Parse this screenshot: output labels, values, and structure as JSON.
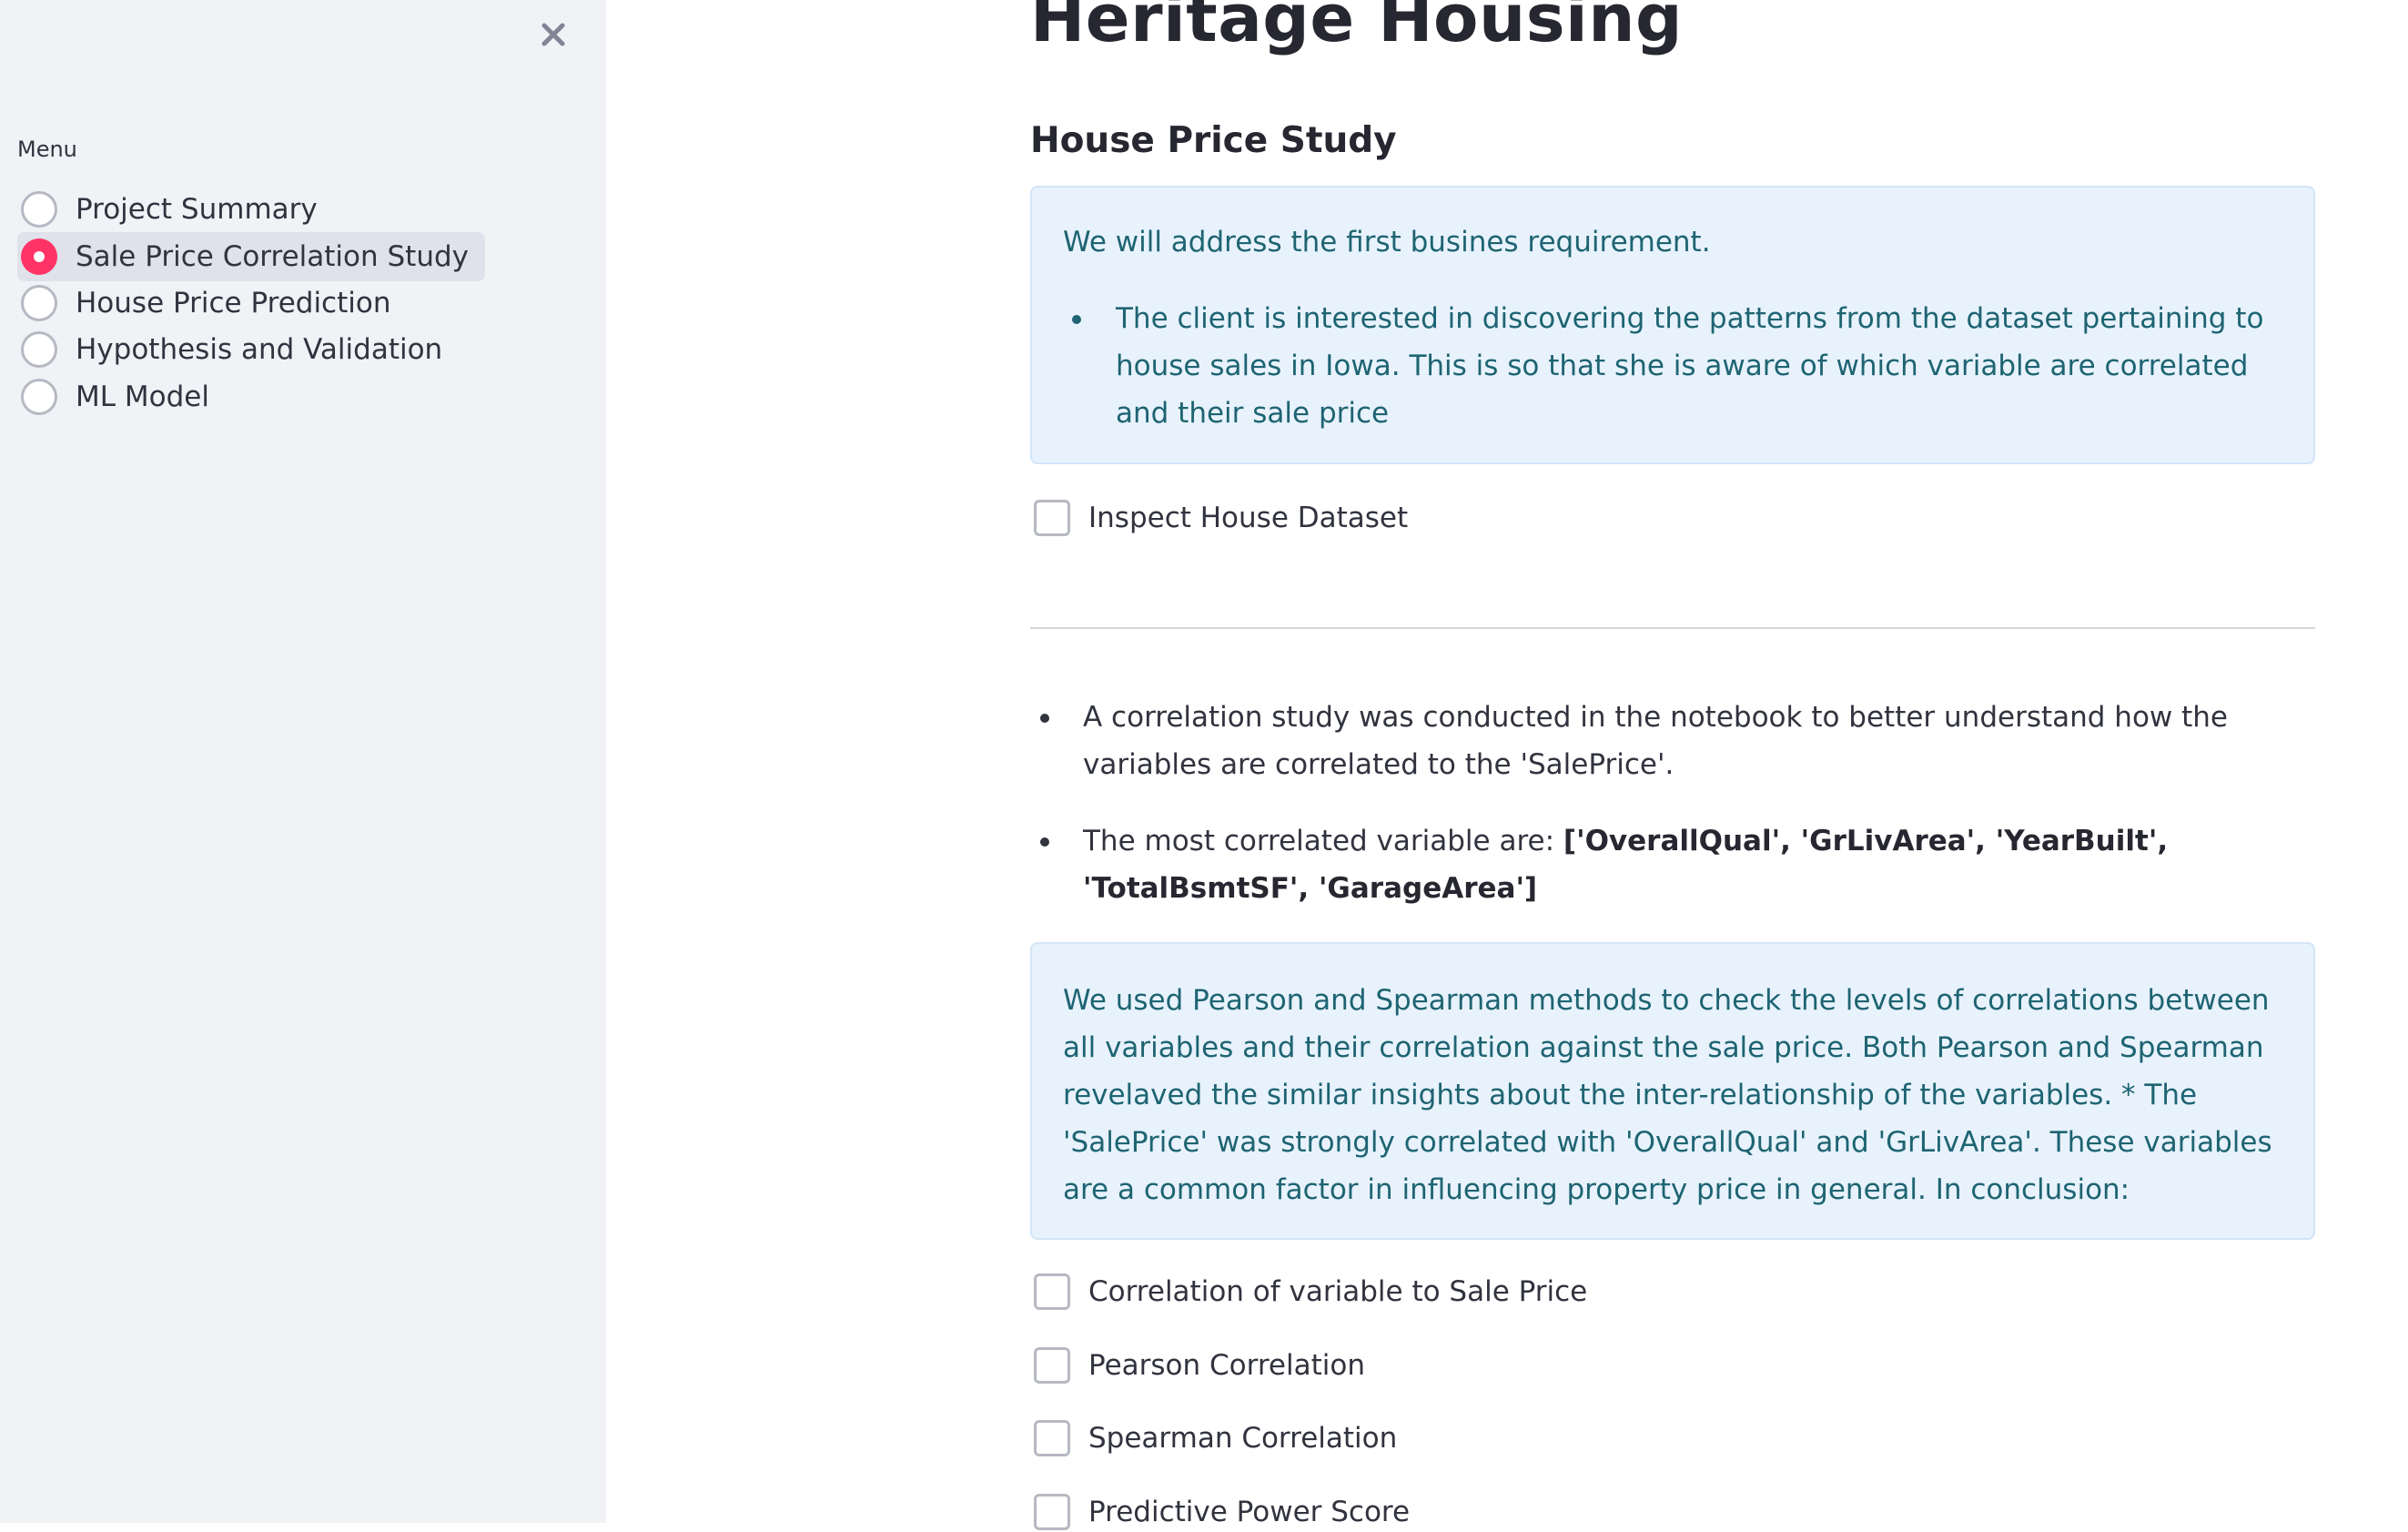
{
  "sidebar": {
    "close_icon": "close-icon",
    "menu_label": "Menu",
    "items": [
      {
        "label": "Project Summary",
        "selected": false
      },
      {
        "label": "Sale Price Correlation Study",
        "selected": true
      },
      {
        "label": "House Price Prediction",
        "selected": false
      },
      {
        "label": "Hypothesis and Validation",
        "selected": false
      },
      {
        "label": "ML Model",
        "selected": false
      }
    ]
  },
  "main": {
    "title": "Heritage Housing",
    "section_title": "House Price Study",
    "info1": {
      "intro": "We will address the first busines requirement.",
      "bullet": "The client is interested in discovering the patterns from the dataset pertaining to house sales in Iowa. This is so that she is aware of which variable are correlated and their sale price"
    },
    "inspect_checkbox": "Inspect House Dataset",
    "bullets": {
      "b1": "A correlation study was conducted in the notebook to better understand how the variables are correlated to the 'SalePrice'.",
      "b2_prefix": "The most correlated variable are: ",
      "b2_bold": "['OverallQual', 'GrLivArea', 'YearBuilt', 'TotalBsmtSF', 'GarageArea']"
    },
    "info2": "We used Pearson and Spearman methods to check the levels of correlations between all variables and their correlation against the sale price. Both Pearson and Spearman revelaved the similar insights about the inter-relationship of the variables. * The 'SalePrice' was strongly correlated with 'OverallQual' and 'GrLivArea'. These variables are a common factor in influencing property price in general. In conclusion:",
    "checkboxes": [
      "Correlation of variable to Sale Price",
      "Pearson Correlation",
      "Spearman Correlation",
      "Predictive Power Score"
    ]
  },
  "colors": {
    "sidebar_bg": "#f0f2f6",
    "accent": "#ff3366",
    "info_bg": "#e8f2fc",
    "info_text": "#1e6472"
  }
}
